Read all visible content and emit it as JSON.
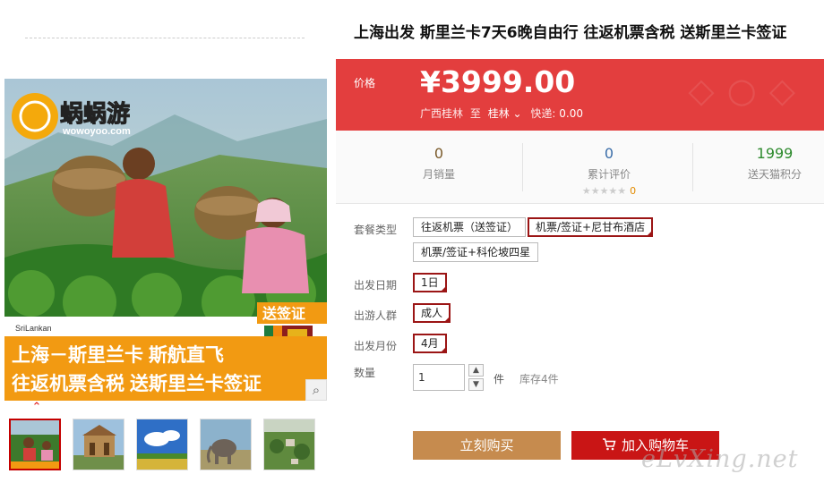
{
  "product": {
    "title": "上海出发 斯里兰卡7天6晚自由行 往返机票含税 送斯里兰卡签证"
  },
  "gallery": {
    "brand_name": "蜗蜗游",
    "brand_url": "wowoyoo.com",
    "visa_badge": "送签证",
    "airline": "SriLankan",
    "banner_line1": "上海－斯里兰卡 斯航直飞",
    "banner_line2": "往返机票含税 送斯里兰卡签证",
    "thumbnails": [
      "tea-pickers",
      "colonial-building",
      "blue-sky-field",
      "elephant",
      "aerial-town"
    ],
    "active_thumb": 0
  },
  "price": {
    "label": "价格",
    "value": "¥3999.00",
    "origin": "广西桂林",
    "to": "至",
    "destination": "桂林",
    "shipping_label": "快递:",
    "shipping_value": "0.00"
  },
  "stats": {
    "monthly_sales": {
      "value": "0",
      "label": "月销量"
    },
    "reviews": {
      "value": "0",
      "label": "累计评价",
      "stars": "★★★★★",
      "score": "0"
    },
    "points": {
      "value": "1999",
      "label": "送天猫积分"
    }
  },
  "options": {
    "package_label": "套餐类型",
    "package_items": [
      "往返机票（送签证）",
      "机票/签证+尼甘布酒店",
      "机票/签证+科伦坡四星"
    ],
    "package_selected": 1,
    "date_label": "出发日期",
    "date_value": "1日",
    "group_label": "出游人群",
    "group_value": "成人",
    "month_label": "出发月份",
    "month_value": "4月",
    "qty_label": "数量",
    "qty_value": "1",
    "qty_unit": "件",
    "stock": "库存4件"
  },
  "actions": {
    "buy_now": "立刻购买",
    "add_to_cart": "加入购物车"
  },
  "watermark": "eLvXing.net",
  "colors": {
    "price_bg": "#e33e3e",
    "buy_button": "#c68b4e",
    "cart_button": "#c91515",
    "selected_border": "#9b1515"
  }
}
